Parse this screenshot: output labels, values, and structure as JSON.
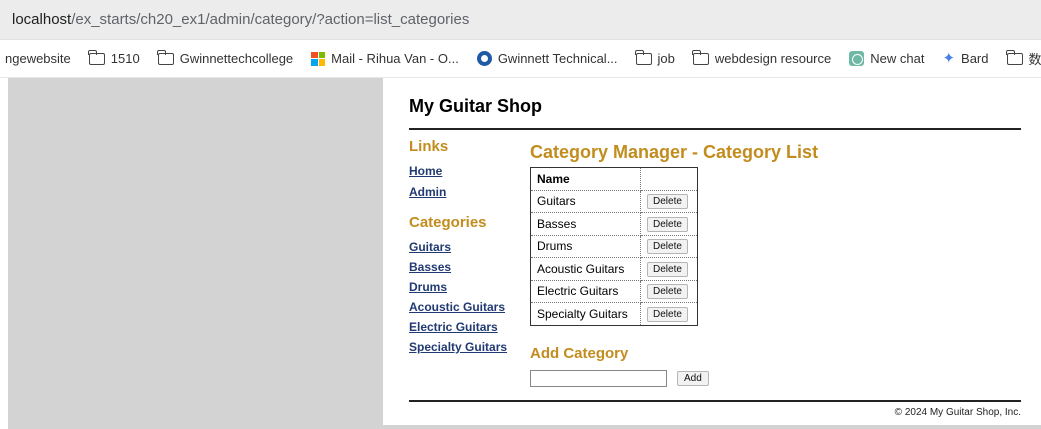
{
  "browser": {
    "address_host": "localhost",
    "address_path": "/ex_starts/ch20_ex1/admin/category/?action=list_categories",
    "bookmarks": [
      {
        "label": "ngewebsite",
        "icon": "none"
      },
      {
        "label": "1510",
        "icon": "folder-icon"
      },
      {
        "label": "Gwinnettechcollege",
        "icon": "folder-icon"
      },
      {
        "label": "Mail - Rihua Van - O...",
        "icon": "microsoft-icon"
      },
      {
        "label": "Gwinnett Technical...",
        "icon": "gwinnett-icon"
      },
      {
        "label": "job",
        "icon": "folder-icon"
      },
      {
        "label": "webdesign resource",
        "icon": "folder-icon"
      },
      {
        "label": "New chat",
        "icon": "chatgpt-icon"
      },
      {
        "label": "Bard",
        "icon": "bard-icon"
      },
      {
        "label": "数字产品",
        "icon": "folder-icon"
      }
    ]
  },
  "site": {
    "title": "My Guitar Shop",
    "footer": "© 2024 My Guitar Shop, Inc."
  },
  "sidebar": {
    "links_heading": "Links",
    "links": [
      "Home",
      "Admin"
    ],
    "categories_heading": "Categories",
    "categories": [
      "Guitars",
      "Basses",
      "Drums",
      "Acoustic Guitars",
      "Electric Guitars",
      "Specialty Guitars"
    ]
  },
  "main": {
    "heading": "Category Manager - Category List",
    "table_header_name": "Name",
    "table_header_action": "",
    "rows": [
      {
        "name": "Guitars",
        "action": "Delete"
      },
      {
        "name": "Basses",
        "action": "Delete"
      },
      {
        "name": "Drums",
        "action": "Delete"
      },
      {
        "name": "Acoustic Guitars",
        "action": "Delete"
      },
      {
        "name": "Electric Guitars",
        "action": "Delete"
      },
      {
        "name": "Specialty Guitars",
        "action": "Delete"
      }
    ],
    "add_heading": "Add Category",
    "add_input_value": "",
    "add_button": "Add"
  },
  "colors": {
    "heading_gold": "#c28d1e",
    "link_navy": "#213a72",
    "side_gray": "#d3d3d3",
    "ms_red": "#f25022",
    "ms_green": "#7fba00",
    "ms_blue": "#00a4ef",
    "ms_yellow": "#ffb900"
  }
}
